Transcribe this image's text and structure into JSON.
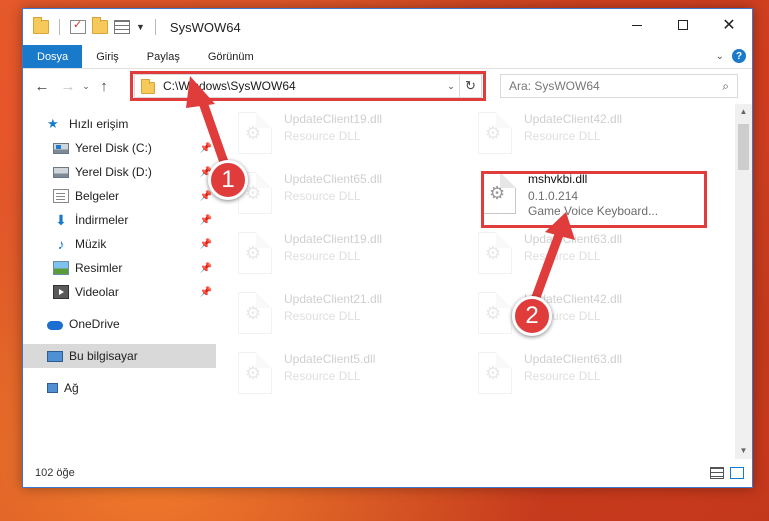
{
  "window": {
    "title": "SysWOW64",
    "controls": {
      "minimize": "",
      "maximize": "",
      "close": "✕"
    }
  },
  "ribbon": {
    "tabs": [
      "Dosya",
      "Giriş",
      "Paylaş",
      "Görünüm"
    ],
    "help": "?"
  },
  "navigation": {
    "back": "←",
    "forward": "→",
    "recent": "⌄",
    "up": "↑",
    "address": "C:\\Windows\\SysWOW64",
    "refresh": "↻",
    "search_placeholder": "Ara: SysWOW64",
    "search_icon_glyph": "⌕"
  },
  "sidebar": {
    "items": [
      {
        "label": "Hızlı erişim",
        "icon": "star-icon",
        "pinned": false
      },
      {
        "label": "Yerel Disk (C:)",
        "icon": "drive-icon",
        "pinned": true
      },
      {
        "label": "Yerel Disk (D:)",
        "icon": "drive-icon",
        "pinned": true
      },
      {
        "label": "Belgeler",
        "icon": "documents-icon",
        "pinned": true
      },
      {
        "label": "İndirmeler",
        "icon": "download-icon",
        "pinned": true
      },
      {
        "label": "Müzik",
        "icon": "music-icon",
        "pinned": true
      },
      {
        "label": "Resimler",
        "icon": "pictures-icon",
        "pinned": true
      },
      {
        "label": "Videolar",
        "icon": "videos-icon",
        "pinned": true
      },
      {
        "label": "OneDrive",
        "icon": "cloud-icon",
        "pinned": false
      },
      {
        "label": "Bu bilgisayar",
        "icon": "pc-icon",
        "pinned": false
      },
      {
        "label": "Ağ",
        "icon": "network-icon",
        "pinned": false
      }
    ],
    "pin_glyph": "📌"
  },
  "files": [
    {
      "name": "UpdateClient19.dll",
      "desc": "Resource DLL",
      "faded": true
    },
    {
      "name": "UpdateClient42.dll",
      "desc": "Resource DLL",
      "faded": true
    },
    {
      "name": "UpdateClient65.dll",
      "desc": "Resource DLL",
      "faded": true
    },
    {
      "name": "mshvkbi.dll",
      "version": "0.1.0.214",
      "desc": "Game Voice Keyboard...",
      "faded": false
    },
    {
      "name": "UpdateClient19.dll",
      "desc": "Resource DLL",
      "faded": true
    },
    {
      "name": "UpdateClient63.dll",
      "desc": "Resource DLL",
      "faded": true
    },
    {
      "name": "UpdateClient21.dll",
      "desc": "Resource DLL",
      "faded": true
    },
    {
      "name": "UpdateClient42.dll",
      "desc": "Resource DLL",
      "faded": true
    },
    {
      "name": "UpdateClient5.dll",
      "desc": "Resource DLL",
      "faded": true
    },
    {
      "name": "UpdateClient63.dll",
      "desc": "Resource DLL",
      "faded": true
    }
  ],
  "status": {
    "count": "102 öğe"
  },
  "annotations": {
    "marker1": "1",
    "marker2": "2",
    "color": "#e03c3c"
  },
  "colors": {
    "accent": "#1979ca",
    "selection": "#cce4f7",
    "highlight": "#e03c3c"
  }
}
